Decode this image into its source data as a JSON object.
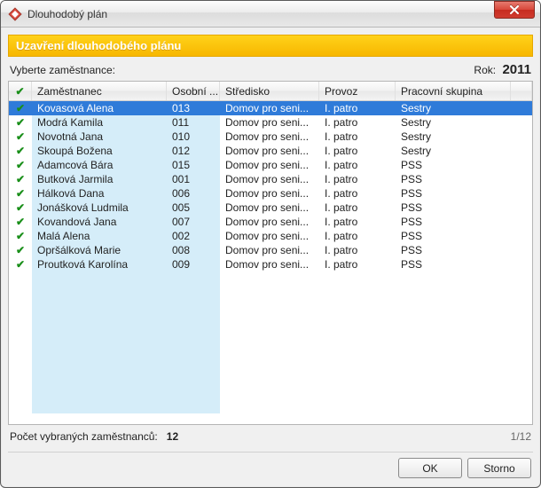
{
  "window": {
    "title": "Dlouhodobý plán",
    "icon": "app-icon"
  },
  "banner": "Uzavření dlouhodobého plánu",
  "subhead": {
    "label": "Vyberte zaměstnance:",
    "year_label": "Rok:",
    "year_value": "2011"
  },
  "columns": {
    "check": "✔",
    "employee": "Zaměstnanec",
    "personal": "Osobní ...",
    "center": "Středisko",
    "operation": "Provoz",
    "workgroup": "Pracovní skupina"
  },
  "rows": [
    {
      "checked": true,
      "employee": "Kovasová Alena",
      "personal": "013",
      "center": "Domov pro seni...",
      "operation": "I. patro",
      "workgroup": "Sestry",
      "selected": true
    },
    {
      "checked": true,
      "employee": "Modrá Kamila",
      "personal": "011",
      "center": "Domov pro seni...",
      "operation": "I. patro",
      "workgroup": "Sestry"
    },
    {
      "checked": true,
      "employee": "Novotná Jana",
      "personal": "010",
      "center": "Domov pro seni...",
      "operation": "I. patro",
      "workgroup": "Sestry"
    },
    {
      "checked": true,
      "employee": "Skoupá Božena",
      "personal": "012",
      "center": "Domov pro seni...",
      "operation": "I. patro",
      "workgroup": "Sestry"
    },
    {
      "checked": true,
      "employee": "Adamcová Bára",
      "personal": "015",
      "center": "Domov pro seni...",
      "operation": "I. patro",
      "workgroup": "PSS"
    },
    {
      "checked": true,
      "employee": "Butková Jarmila",
      "personal": "001",
      "center": "Domov pro seni...",
      "operation": "I. patro",
      "workgroup": "PSS"
    },
    {
      "checked": true,
      "employee": "Hálková Dana",
      "personal": "006",
      "center": "Domov pro seni...",
      "operation": "I. patro",
      "workgroup": "PSS"
    },
    {
      "checked": true,
      "employee": "Jonášková Ludmila",
      "personal": "005",
      "center": "Domov pro seni...",
      "operation": "I. patro",
      "workgroup": "PSS"
    },
    {
      "checked": true,
      "employee": "Kovandová Jana",
      "personal": "007",
      "center": "Domov pro seni...",
      "operation": "I. patro",
      "workgroup": "PSS"
    },
    {
      "checked": true,
      "employee": "Malá Alena",
      "personal": "002",
      "center": "Domov pro seni...",
      "operation": "I. patro",
      "workgroup": "PSS"
    },
    {
      "checked": true,
      "employee": "Opršálková Marie",
      "personal": "008",
      "center": "Domov pro seni...",
      "operation": "I. patro",
      "workgroup": "PSS"
    },
    {
      "checked": true,
      "employee": "Proutková Karolína",
      "personal": "009",
      "center": "Domov pro seni...",
      "operation": "I. patro",
      "workgroup": "PSS"
    }
  ],
  "footer": {
    "count_label": "Počet vybraných zaměstnanců:",
    "count_value": "12",
    "pager": "1/12"
  },
  "buttons": {
    "ok": "OK",
    "cancel": "Storno"
  },
  "colors": {
    "banner_bg": "#f7b700",
    "selection": "#2f7bd9",
    "highlight": "#d5edf9",
    "check": "#1a8f1a"
  }
}
